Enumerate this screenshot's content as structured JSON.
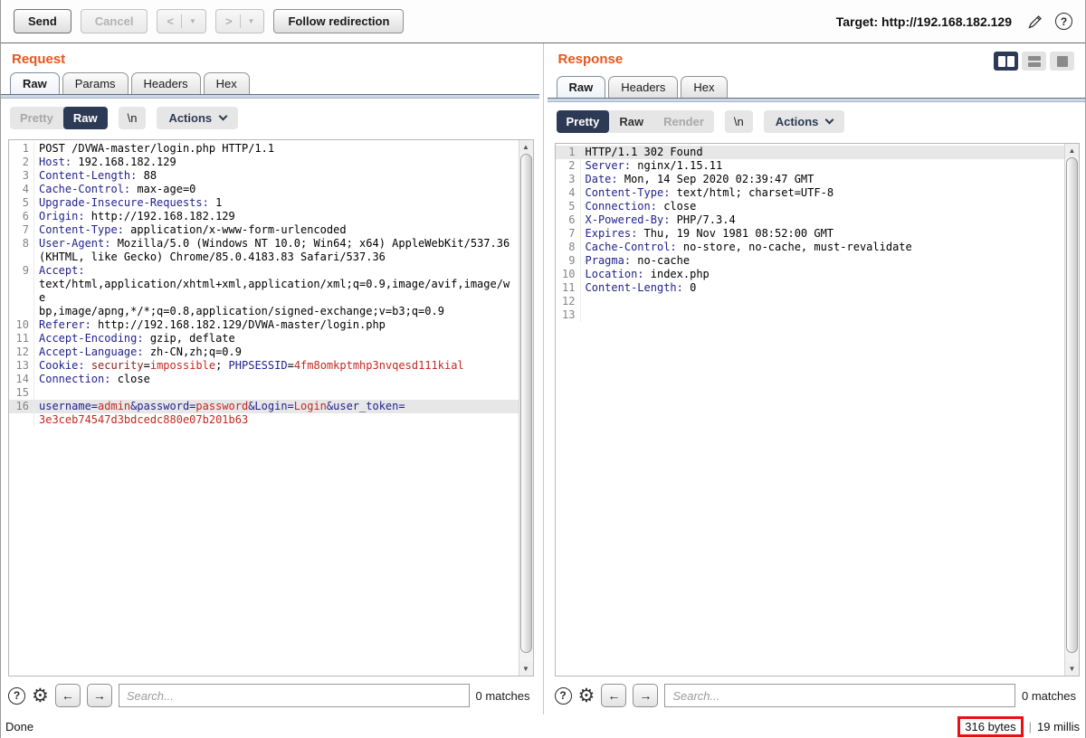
{
  "topbar": {
    "send": "Send",
    "cancel": "Cancel",
    "back": "<",
    "forward": ">",
    "caret": "▼",
    "follow_redirection": "Follow redirection",
    "target": "Target: http://192.168.182.129",
    "help": "?"
  },
  "request": {
    "title": "Request",
    "tabs": [
      {
        "label": "Raw",
        "selected": true
      },
      {
        "label": "Params"
      },
      {
        "label": "Headers"
      },
      {
        "label": "Hex"
      }
    ],
    "view_buttons": [
      {
        "label": "Pretty",
        "state": "disabled"
      },
      {
        "label": "Raw",
        "state": "selected"
      }
    ],
    "newline_button": "\\n",
    "actions_label": "Actions",
    "search_placeholder": "Search...",
    "matches": "0 matches",
    "help": "?",
    "gear_icon": "⚙",
    "lines": [
      {
        "n": "1",
        "seg": [
          [
            "p",
            "POST /DVWA-master/login.php HTTP/1.1"
          ]
        ]
      },
      {
        "n": "2",
        "seg": [
          [
            "h",
            "Host:"
          ],
          [
            "p",
            " 192.168.182.129"
          ]
        ]
      },
      {
        "n": "3",
        "seg": [
          [
            "h",
            "Content-Length:"
          ],
          [
            "p",
            " 88"
          ]
        ]
      },
      {
        "n": "4",
        "seg": [
          [
            "h",
            "Cache-Control:"
          ],
          [
            "p",
            " max-age=0"
          ]
        ]
      },
      {
        "n": "5",
        "seg": [
          [
            "h",
            "Upgrade-Insecure-Requests:"
          ],
          [
            "p",
            " 1"
          ]
        ]
      },
      {
        "n": "6",
        "seg": [
          [
            "h",
            "Origin:"
          ],
          [
            "p",
            " http://192.168.182.129"
          ]
        ]
      },
      {
        "n": "7",
        "seg": [
          [
            "h",
            "Content-Type:"
          ],
          [
            "p",
            " application/x-www-form-urlencoded"
          ]
        ]
      },
      {
        "n": "8",
        "seg": [
          [
            "h",
            "User-Agent:"
          ],
          [
            "p",
            " Mozilla/5.0 (Windows NT 10.0; Win64; x64) AppleWebKit/537.36"
          ]
        ]
      },
      {
        "n": "",
        "seg": [
          [
            "p",
            "(KHTML, like Gecko) Chrome/85.0.4183.83 Safari/537.36"
          ]
        ]
      },
      {
        "n": "9",
        "seg": [
          [
            "h",
            "Accept:"
          ]
        ]
      },
      {
        "n": "",
        "seg": [
          [
            "p",
            "text/html,application/xhtml+xml,application/xml;q=0.9,image/avif,image/we"
          ]
        ]
      },
      {
        "n": "",
        "seg": [
          [
            "p",
            "bp,image/apng,*/*;q=0.8,application/signed-exchange;v=b3;q=0.9"
          ]
        ]
      },
      {
        "n": "10",
        "seg": [
          [
            "h",
            "Referer:"
          ],
          [
            "p",
            " http://192.168.182.129/DVWA-master/login.php"
          ]
        ]
      },
      {
        "n": "11",
        "seg": [
          [
            "h",
            "Accept-Encoding:"
          ],
          [
            "p",
            " gzip, deflate"
          ]
        ]
      },
      {
        "n": "12",
        "seg": [
          [
            "h",
            "Accept-Language:"
          ],
          [
            "p",
            " zh-CN,zh;q=0.9"
          ]
        ]
      },
      {
        "n": "13",
        "seg": [
          [
            "h",
            "Cookie:"
          ],
          [
            "p",
            " "
          ],
          [
            "m",
            "security"
          ],
          [
            "p",
            "="
          ],
          [
            "r",
            "impossible"
          ],
          [
            "p",
            "; "
          ],
          [
            "h",
            "PHPSESSID"
          ],
          [
            "p",
            "="
          ],
          [
            "r",
            "4fm8omkptmhp3nvqesd111kial"
          ]
        ]
      },
      {
        "n": "14",
        "seg": [
          [
            "h",
            "Connection:"
          ],
          [
            "p",
            " close"
          ]
        ]
      },
      {
        "n": "15",
        "seg": []
      },
      {
        "n": "16",
        "hl": true,
        "seg": [
          [
            "h",
            "username="
          ],
          [
            "r",
            "admin"
          ],
          [
            "h",
            "&password="
          ],
          [
            "r",
            "password"
          ],
          [
            "h",
            "&Login="
          ],
          [
            "r",
            "Login"
          ],
          [
            "h",
            "&user_token="
          ]
        ]
      },
      {
        "n": "",
        "seg": [
          [
            "r",
            "3e3ceb74547d3bdcedc880e07b201b63"
          ]
        ]
      }
    ]
  },
  "response": {
    "title": "Response",
    "tabs": [
      {
        "label": "Raw",
        "selected": true
      },
      {
        "label": "Headers"
      },
      {
        "label": "Hex"
      }
    ],
    "view_buttons": [
      {
        "label": "Pretty",
        "state": "selected"
      },
      {
        "label": "Raw"
      },
      {
        "label": "Render",
        "state": "disabled"
      }
    ],
    "newline_button": "\\n",
    "actions_label": "Actions",
    "search_placeholder": "Search...",
    "matches": "0 matches",
    "help": "?",
    "gear_icon": "⚙",
    "lines": [
      {
        "n": "1",
        "hl": true,
        "seg": [
          [
            "p",
            "HTTP/1.1 302 Found"
          ]
        ]
      },
      {
        "n": "2",
        "seg": [
          [
            "h",
            "Server:"
          ],
          [
            "p",
            " nginx/1.15.11"
          ]
        ]
      },
      {
        "n": "3",
        "seg": [
          [
            "h",
            "Date:"
          ],
          [
            "p",
            " Mon, 14 Sep 2020 02:39:47 GMT"
          ]
        ]
      },
      {
        "n": "4",
        "seg": [
          [
            "h",
            "Content-Type:"
          ],
          [
            "p",
            " text/html; charset=UTF-8"
          ]
        ]
      },
      {
        "n": "5",
        "seg": [
          [
            "h",
            "Connection:"
          ],
          [
            "p",
            " close"
          ]
        ]
      },
      {
        "n": "6",
        "seg": [
          [
            "h",
            "X-Powered-By:"
          ],
          [
            "p",
            " PHP/7.3.4"
          ]
        ]
      },
      {
        "n": "7",
        "seg": [
          [
            "h",
            "Expires:"
          ],
          [
            "p",
            " Thu, 19 Nov 1981 08:52:00 GMT"
          ]
        ]
      },
      {
        "n": "8",
        "seg": [
          [
            "h",
            "Cache-Control:"
          ],
          [
            "p",
            " no-store, no-cache, must-revalidate"
          ]
        ]
      },
      {
        "n": "9",
        "seg": [
          [
            "h",
            "Pragma:"
          ],
          [
            "p",
            " no-cache"
          ]
        ]
      },
      {
        "n": "10",
        "seg": [
          [
            "h",
            "Location:"
          ],
          [
            "p",
            " index.php"
          ]
        ]
      },
      {
        "n": "11",
        "seg": [
          [
            "h",
            "Content-Length:"
          ],
          [
            "p",
            " 0"
          ]
        ]
      },
      {
        "n": "12",
        "seg": []
      },
      {
        "n": "13",
        "seg": []
      }
    ]
  },
  "statusbar": {
    "status": "Done",
    "response_size": "316 bytes",
    "separator": "|",
    "response_time": "19 millis"
  },
  "colors": {
    "accent_orange": "#e8561e",
    "selected_navy": "#2d3a55",
    "header_name_blue": "#22228e",
    "value_red": "#c22a21",
    "cookie_name_maroon": "#8e2323",
    "annotation_red": "#ea1010"
  }
}
